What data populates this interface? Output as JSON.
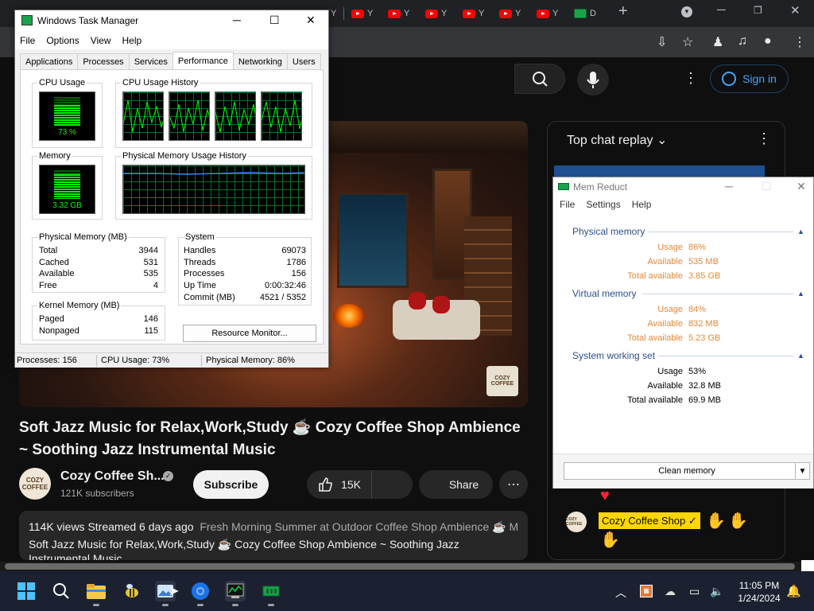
{
  "chrome": {
    "tab_letter": "Y",
    "last_tab_letter": "D",
    "new_tab": "+"
  },
  "youtube": {
    "sign_in": "Sign in",
    "video_logo_text": "COZY COFFEE",
    "title": "Soft Jazz Music for Relax,Work,Study ☕ Cozy Coffee Shop Ambience ~ Soothing Jazz Instrumental Music",
    "channel_name": "Cozy Coffee Sh...",
    "subscribers": "121K subscribers",
    "subscribe_label": "Subscribe",
    "likes": "15K",
    "share_label": "Share",
    "description_meta": "114K views  Streamed 6 days ago",
    "description_tags": "Fresh Morning Summer at Outdoor Coffee Shop Ambience ☕ M",
    "description_text": "Soft Jazz Music for Relax,Work,Study ☕ Cozy Coffee Shop Ambience ~ Soothing Jazz Instrumental Music",
    "avatar_text": "COZY COFFEE"
  },
  "chat": {
    "title": "Top chat replay",
    "author_badge": "Cozy Coffee Shop ✓"
  },
  "taskbar": {
    "time": "11:05 PM",
    "date": "1/24/2024"
  },
  "task_manager": {
    "window_title": "Windows Task Manager",
    "menu": [
      "File",
      "Options",
      "View",
      "Help"
    ],
    "tabs": [
      "Applications",
      "Processes",
      "Services",
      "Performance",
      "Networking",
      "Users"
    ],
    "active_tab": "Performance",
    "cpu_usage_label": "CPU Usage",
    "cpu_usage_value": "73 %",
    "cpu_usage_percent": 73,
    "cpu_history_label": "CPU Usage History",
    "memory_label": "Memory",
    "memory_value": "3.32 GB",
    "memory_percent": 86,
    "phys_history_label": "Physical Memory Usage History",
    "physical_memory": {
      "label": "Physical Memory (MB)",
      "rows": [
        {
          "k": "Total",
          "v": "3944"
        },
        {
          "k": "Cached",
          "v": "531"
        },
        {
          "k": "Available",
          "v": "535"
        },
        {
          "k": "Free",
          "v": "4"
        }
      ]
    },
    "kernel_memory": {
      "label": "Kernel Memory (MB)",
      "rows": [
        {
          "k": "Paged",
          "v": "146"
        },
        {
          "k": "Nonpaged",
          "v": "115"
        }
      ]
    },
    "system": {
      "label": "System",
      "rows": [
        {
          "k": "Handles",
          "v": "69073"
        },
        {
          "k": "Threads",
          "v": "1786"
        },
        {
          "k": "Processes",
          "v": "156"
        },
        {
          "k": "Up Time",
          "v": "0:00:32:46"
        },
        {
          "k": "Commit (MB)",
          "v": "4521 / 5352"
        }
      ]
    },
    "resource_monitor_button": "Resource Monitor...",
    "status": {
      "processes": "Processes: 156",
      "cpu": "CPU Usage: 73%",
      "memory": "Physical Memory: 86%"
    }
  },
  "mem_reduct": {
    "window_title": "Mem Reduct",
    "menu": [
      "File",
      "Settings",
      "Help"
    ],
    "sections": [
      {
        "title": "Physical memory",
        "rows": [
          {
            "k": "Usage",
            "v": "86%"
          },
          {
            "k": "Available",
            "v": "535 MB"
          },
          {
            "k": "Total available",
            "v": "3.85 GB"
          }
        ]
      },
      {
        "title": "Virtual memory",
        "rows": [
          {
            "k": "Usage",
            "v": "84%"
          },
          {
            "k": "Available",
            "v": "832 MB"
          },
          {
            "k": "Total available",
            "v": "5.23 GB"
          }
        ]
      },
      {
        "title": "System working set",
        "rows": [
          {
            "k": "Usage",
            "v": "53%"
          },
          {
            "k": "Available",
            "v": "32.8 MB"
          },
          {
            "k": "Total available",
            "v": "69.9 MB"
          }
        ]
      }
    ],
    "clean_button": "Clean memory"
  }
}
